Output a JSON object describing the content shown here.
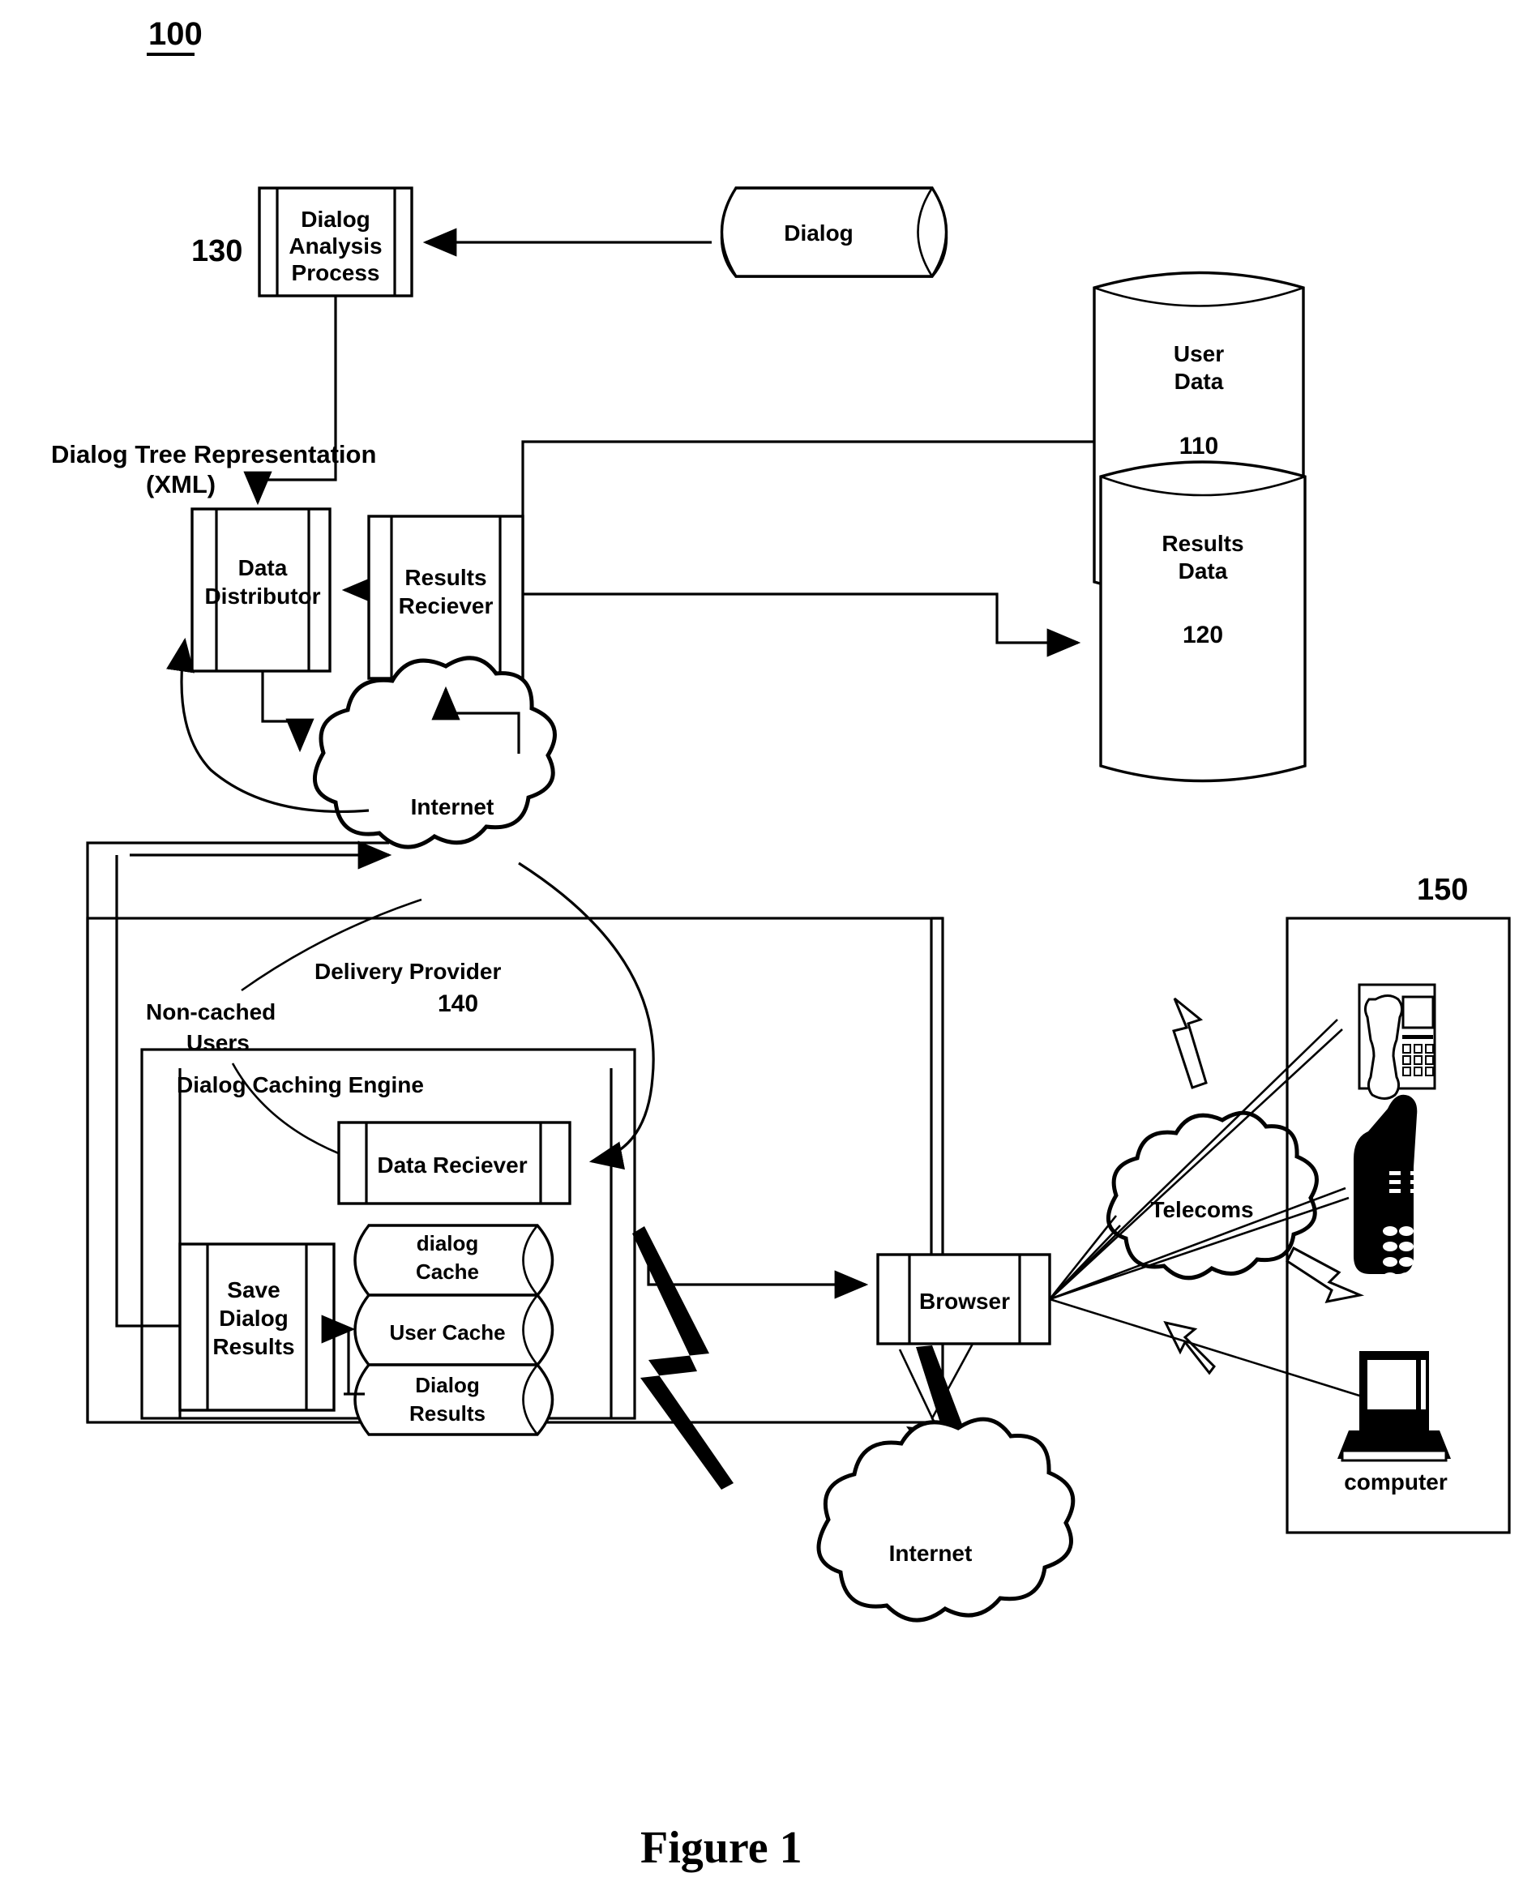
{
  "figure": {
    "system_number": "100",
    "caption": "Figure 1"
  },
  "reference_numerals": {
    "dialog_analysis": "130",
    "user_data": "110",
    "results_data": "120",
    "delivery_provider": "140",
    "devices_panel": "150"
  },
  "nodes": {
    "dialog_analysis_process": "Dialog\nAnalysis\nProcess",
    "dialog_analysis_line1": "Dialog",
    "dialog_analysis_line2": "Analysis",
    "dialog_analysis_line3": "Process",
    "dialog_store": "Dialog",
    "user_data_line1": "User",
    "user_data_line2": "Data",
    "data_distributor_line1": "Data",
    "data_distributor_line2": "Distributor",
    "results_receiver_line1": "Results",
    "results_receiver_line2": "Reciever",
    "results_data_line1": "Results",
    "results_data_line2": "Data",
    "internet_top": "Internet",
    "internet_bottom": "Internet",
    "data_receiver": "Data Reciever",
    "save_dialog_results_line1": "Save",
    "save_dialog_results_line2": "Dialog",
    "save_dialog_results_line3": "Results",
    "dialog_cache_line1": "dialog",
    "dialog_cache_line2": "Cache",
    "user_cache": "User Cache",
    "dialog_results_line1": "Dialog",
    "dialog_results_line2": "Results",
    "browser": "Browser",
    "telecoms": "Telecoms",
    "computer": "computer"
  },
  "annotations": {
    "dialog_tree_line1": "Dialog Tree Representation",
    "dialog_tree_line2": "(XML)",
    "delivery_provider": "Delivery Provider",
    "non_cached_line1": "Non-cached",
    "non_cached_line2": "Users",
    "dialog_caching_engine": "Dialog Caching Engine"
  },
  "colors": {
    "stroke": "#000000",
    "fill": "#ffffff"
  }
}
